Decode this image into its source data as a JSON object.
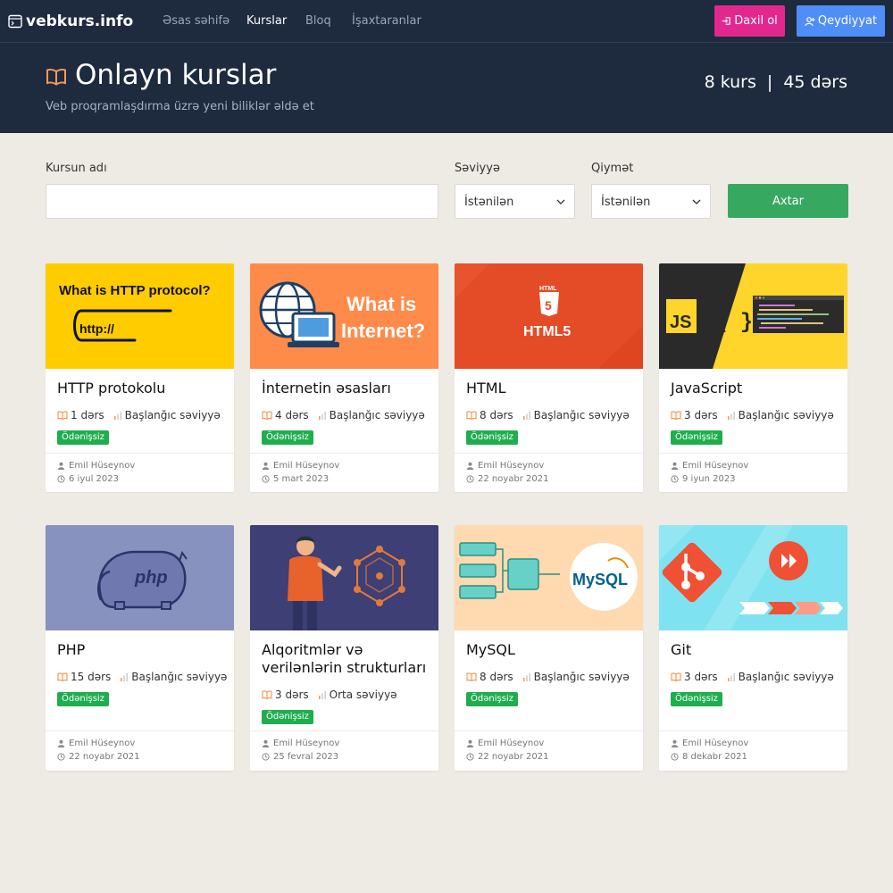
{
  "nav": {
    "brand": "vebkurs.info",
    "links": [
      "Əsas səhifə",
      "Kurslar",
      "Bloq",
      "İşaxtaranlar"
    ],
    "active_index": 1,
    "login_label": "Daxil ol",
    "register_label": "Qeydiyyat"
  },
  "hero": {
    "title": "Onlayn kurslar",
    "subtitle": "Veb proqramlaşdırma üzrə yeni biliklər əldə et",
    "courses_count": "8 kurs",
    "separator": "|",
    "lessons_count": "45 dərs"
  },
  "filters": {
    "name_label": "Kursun adı",
    "name_value": "",
    "level_label": "Səviyyə",
    "level_value": "İstənilən",
    "price_label": "Qiymət",
    "price_value": "İstənilən",
    "search_label": "Axtar"
  },
  "colors": {
    "navbar": "#1e2a3e",
    "login": "#e2288e",
    "register": "#4f8ef7",
    "search": "#37a860",
    "badge": "#1fae4e",
    "book_icon": "#f39c5a"
  },
  "courses": [
    {
      "title": "HTTP protokolu",
      "lessons": "1 dərs",
      "level": "Başlanğıc səviyyə",
      "price": "Ödənişsiz",
      "author": "Emil Hüseynov",
      "date": "6 iyul 2023",
      "thumb_text_1": "What is HTTP protocol?",
      "thumb_text_2": "http://"
    },
    {
      "title": "İnternetin əsasları",
      "lessons": "4 dərs",
      "level": "Başlanğıc səviyyə",
      "price": "Ödənişsiz",
      "author": "Emil Hüseynov",
      "date": "5 mart 2023",
      "thumb_text_1": "What is",
      "thumb_text_2": "Internet?"
    },
    {
      "title": "HTML",
      "lessons": "8 dərs",
      "level": "Başlanğıc səviyyə",
      "price": "Ödənişsiz",
      "author": "Emil Hüseynov",
      "date": "22 noyabr 2021",
      "thumb_text_1": "HTML",
      "thumb_text_2": "HTML5"
    },
    {
      "title": "JavaScript",
      "lessons": "3 dərs",
      "level": "Başlanğıc səviyyə",
      "price": "Ödənişsiz",
      "author": "Emil Hüseynov",
      "date": "9 iyun 2023",
      "thumb_text_1": "JS",
      "thumb_text_2": "{ }"
    },
    {
      "title": "PHP",
      "lessons": "15 dərs",
      "level": "Başlanğıc səviyyə",
      "price": "Ödənişsiz",
      "author": "Emil Hüseynov",
      "date": "22 noyabr 2021",
      "thumb_text_1": "php",
      "thumb_text_2": ""
    },
    {
      "title": "Alqoritmlər və verilənlərin strukturları",
      "lessons": "3 dərs",
      "level": "Orta səviyyə",
      "price": "Ödənişsiz",
      "author": "Emil Hüseynov",
      "date": "25 fevral 2023",
      "thumb_text_1": "",
      "thumb_text_2": ""
    },
    {
      "title": "MySQL",
      "lessons": "8 dərs",
      "level": "Başlanğıc səviyyə",
      "price": "Ödənişsiz",
      "author": "Emil Hüseynov",
      "date": "22 noyabr 2021",
      "thumb_text_1": "MySQL",
      "thumb_text_2": ""
    },
    {
      "title": "Git",
      "lessons": "3 dərs",
      "level": "Başlanğıc səviyyə",
      "price": "Ödənişsiz",
      "author": "Emil Hüseynov",
      "date": "8 dekabr 2021",
      "thumb_text_1": "",
      "thumb_text_2": ""
    }
  ]
}
